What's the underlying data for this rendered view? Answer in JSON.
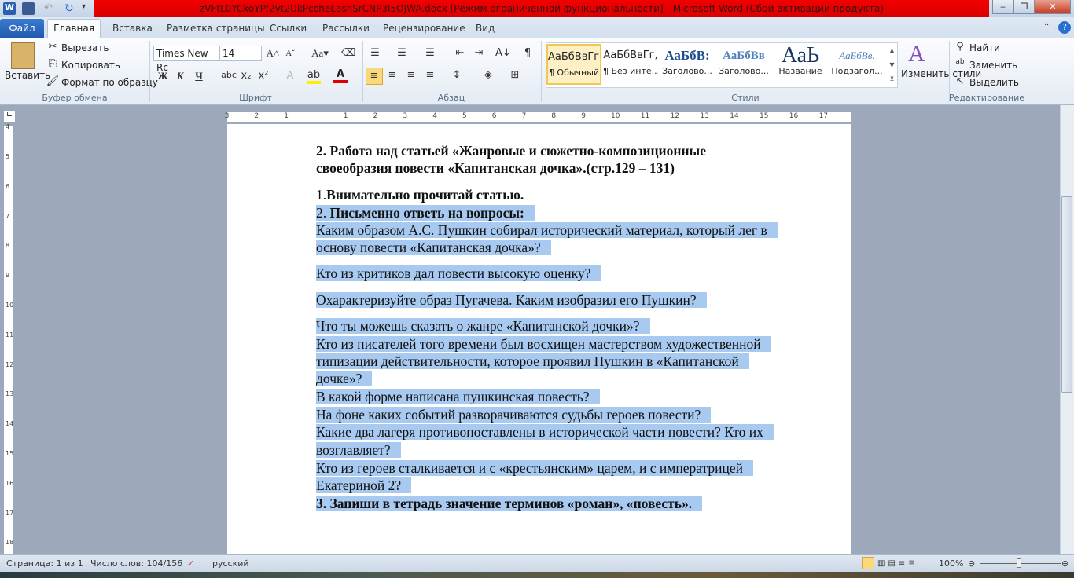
{
  "title": "zVFtL0YCkoYPf2yt2UkPccheLashSrCNP3I5OJWA.docx [Режим ограниченной функциональности]  -  Microsoft Word (Сбой активации продукта)",
  "tabs": {
    "file": "Файл",
    "home": "Главная",
    "insert": "Вставка",
    "layout": "Разметка страницы",
    "refs": "Ссылки",
    "mail": "Рассылки",
    "review": "Рецензирование",
    "view": "Вид"
  },
  "clipboard": {
    "paste": "Вставить",
    "cut": "Вырезать",
    "copy": "Копировать",
    "format": "Формат по образцу",
    "group": "Буфер обмена"
  },
  "font": {
    "name": "Times New Rc",
    "size": "14",
    "group": "Шрифт",
    "bold": "Ж",
    "italic": "К",
    "underline": "Ч"
  },
  "paragraph": {
    "group": "Абзац"
  },
  "styles": {
    "group": "Стили",
    "items": [
      {
        "preview": "АаБбВвГг,",
        "label": "¶ Обычный"
      },
      {
        "preview": "АаБбВвГг,",
        "label": "¶ Без инте..."
      },
      {
        "preview": "АаБбВ:",
        "label": "Заголово..."
      },
      {
        "preview": "АаБбВв",
        "label": "Заголово..."
      },
      {
        "preview": "АаЬ",
        "label": "Название"
      },
      {
        "preview": "АаБбВв.",
        "label": "Подзагол..."
      }
    ],
    "change": "Изменить стили"
  },
  "editing": {
    "find": "Найти",
    "replace": "Заменить",
    "select": "Выделить",
    "group": "Редактирование"
  },
  "document": {
    "lines": [
      {
        "parts": [
          {
            "t": "2. Работа над статьей «Жанровые и сюжетно-композиционные",
            "b": true
          }
        ],
        "sel": false
      },
      {
        "parts": [
          {
            "t": "своеобразия повести «Капитанская дочка».(стр.129 – 131)",
            "b": true
          }
        ],
        "sel": false
      },
      {
        "parts": [
          {
            "t": "1.",
            "b": false
          },
          {
            "t": "Внимательно прочитай статью.",
            "b": true
          }
        ],
        "sel": false
      },
      {
        "parts": [
          {
            "t": "2. ",
            "b": false
          },
          {
            "t": "Письменно ответь на вопросы:",
            "b": true
          }
        ],
        "sel": true
      },
      {
        "parts": [
          {
            "t": "Каким образом А.С. Пушкин собирал исторический материал, который лег в",
            "b": false
          }
        ],
        "sel": true
      },
      {
        "parts": [
          {
            "t": "основу повести «Капитанская дочка»?",
            "b": false
          }
        ],
        "sel": true
      },
      {
        "parts": [
          {
            "t": "Кто из критиков дал повести высокую оценку?",
            "b": false
          }
        ],
        "sel": true
      },
      {
        "parts": [
          {
            "t": "Охарактеризуйте образ Пугачева. Каким изобразил его Пушкин?",
            "b": false
          }
        ],
        "sel": true
      },
      {
        "parts": [
          {
            "t": "Что ты можешь сказать о жанре «Капитанской дочки»?",
            "b": false
          }
        ],
        "sel": true
      },
      {
        "parts": [
          {
            "t": "Кто из писателей того времени был восхищен мастерством художественной",
            "b": false
          }
        ],
        "sel": true
      },
      {
        "parts": [
          {
            "t": "типизации действительности, которое проявил Пушкин в «Капитанской",
            "b": false
          }
        ],
        "sel": true
      },
      {
        "parts": [
          {
            "t": "дочке»?",
            "b": false
          }
        ],
        "sel": true
      },
      {
        "parts": [
          {
            "t": "В какой форме написана пушкинская повесть?",
            "b": false
          }
        ],
        "sel": true
      },
      {
        "parts": [
          {
            "t": "На фоне каких событий разворачиваются судьбы героев повести?",
            "b": false
          }
        ],
        "sel": true
      },
      {
        "parts": [
          {
            "t": "Какие два лагеря противопоставлены в исторической части повести? Кто их",
            "b": false
          }
        ],
        "sel": true
      },
      {
        "parts": [
          {
            "t": "возглавляет?",
            "b": false
          }
        ],
        "sel": true
      },
      {
        "parts": [
          {
            "t": "Кто из героев сталкивается и с «крестьянским» царем, и с императрицей",
            "b": false
          }
        ],
        "sel": true
      },
      {
        "parts": [
          {
            "t": "Екатериной 2?",
            "b": false
          }
        ],
        "sel": true
      },
      {
        "parts": [
          {
            "t": "3. Запиши в тетрадь значение терминов «роман», «повесть».",
            "b": true
          }
        ],
        "sel": true
      }
    ]
  },
  "status": {
    "page": "Страница: 1 из 1",
    "words": "Число слов: 104/156",
    "lang": "русский",
    "zoom": "100%"
  }
}
